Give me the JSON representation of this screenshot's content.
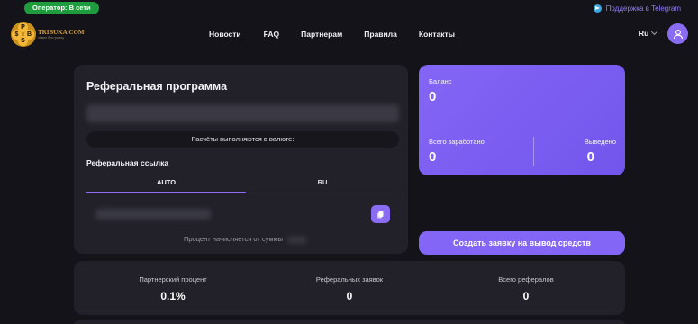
{
  "topbar": {
    "operator_status": "Оператор: В сети",
    "support_link": "Поддержка в Telegram"
  },
  "logo": {
    "name": "TRIBUKA.COM",
    "tagline": "обмен без границ",
    "letters": [
      "P",
      "$",
      "B",
      "S"
    ]
  },
  "nav": {
    "items": [
      "Новости",
      "FAQ",
      "Партнерам",
      "Правила",
      "Контакты"
    ]
  },
  "language": {
    "selected": "Ru"
  },
  "referral": {
    "title": "Реферальная программа",
    "currency_note": "Расчёты выполняются в валюте:",
    "link_title": "Реферальная ссылка",
    "tabs": [
      "AUTO",
      "RU"
    ],
    "active_tab": "AUTO",
    "percent_note": "Процент начисляется от суммы"
  },
  "balance": {
    "balance_label": "Баланс",
    "balance_value": "0",
    "earned_label": "Всего заработано",
    "earned_value": "0",
    "withdrawn_label": "Выведено",
    "withdrawn_value": "0"
  },
  "withdraw_button": "Создать заявку на вывод средств",
  "stats": [
    {
      "label": "Партнерский процент",
      "value": "0.1%"
    },
    {
      "label": "Реферальных заявок",
      "value": "0"
    },
    {
      "label": "Всего рефералов",
      "value": "0"
    }
  ],
  "colors": {
    "background": "#141319",
    "card": "#22212a",
    "accent": "#8466f6",
    "status_green": "#1f9d3e",
    "link": "#8f7cf6"
  },
  "icons": [
    "telegram-icon",
    "chevron-down-icon",
    "user-icon",
    "copy-icon"
  ]
}
